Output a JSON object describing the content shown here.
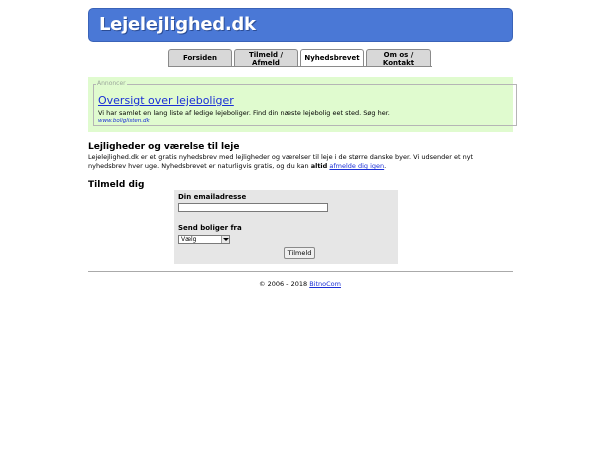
{
  "header": {
    "logo": "Lejelejlighed.dk"
  },
  "tabs": [
    {
      "label": "Forsiden"
    },
    {
      "line1": "Tilmeld /",
      "line2": "Afmeld"
    },
    {
      "label": "Nyhedsbrevet"
    },
    {
      "line1": "Om os /",
      "line2": "Kontakt"
    }
  ],
  "ad": {
    "legend": "Annoncer",
    "title": "Oversigt over lejeboliger",
    "description": "Vi har samlet en lang liste af ledige lejeboliger. Find din næste lejebolig eet sted. Søg her.",
    "url": "www.boliglisten.dk"
  },
  "main": {
    "heading": "Lejligheder og værelse til leje",
    "intro_text": "Lejelejlighed.dk er et gratis nyhedsbrev med lejligheder og værelser til leje i de større danske byer. Vi udsender et nyt nyhedsbrev hver uge. Nyhedsbrevet er naturligvis gratis, og du kan",
    "intro_bold": "altid",
    "intro_link": "afmelde dig igen",
    "intro_end": "."
  },
  "signup": {
    "heading": "Tilmeld dig",
    "email_label": "Din emailadresse",
    "email_value": "",
    "send_label": "Send boliger fra",
    "select_value": "Vælg",
    "submit": "Tilmeld"
  },
  "footer": {
    "copyright": "© 2006 - 2018",
    "link": "BitnoCom"
  }
}
